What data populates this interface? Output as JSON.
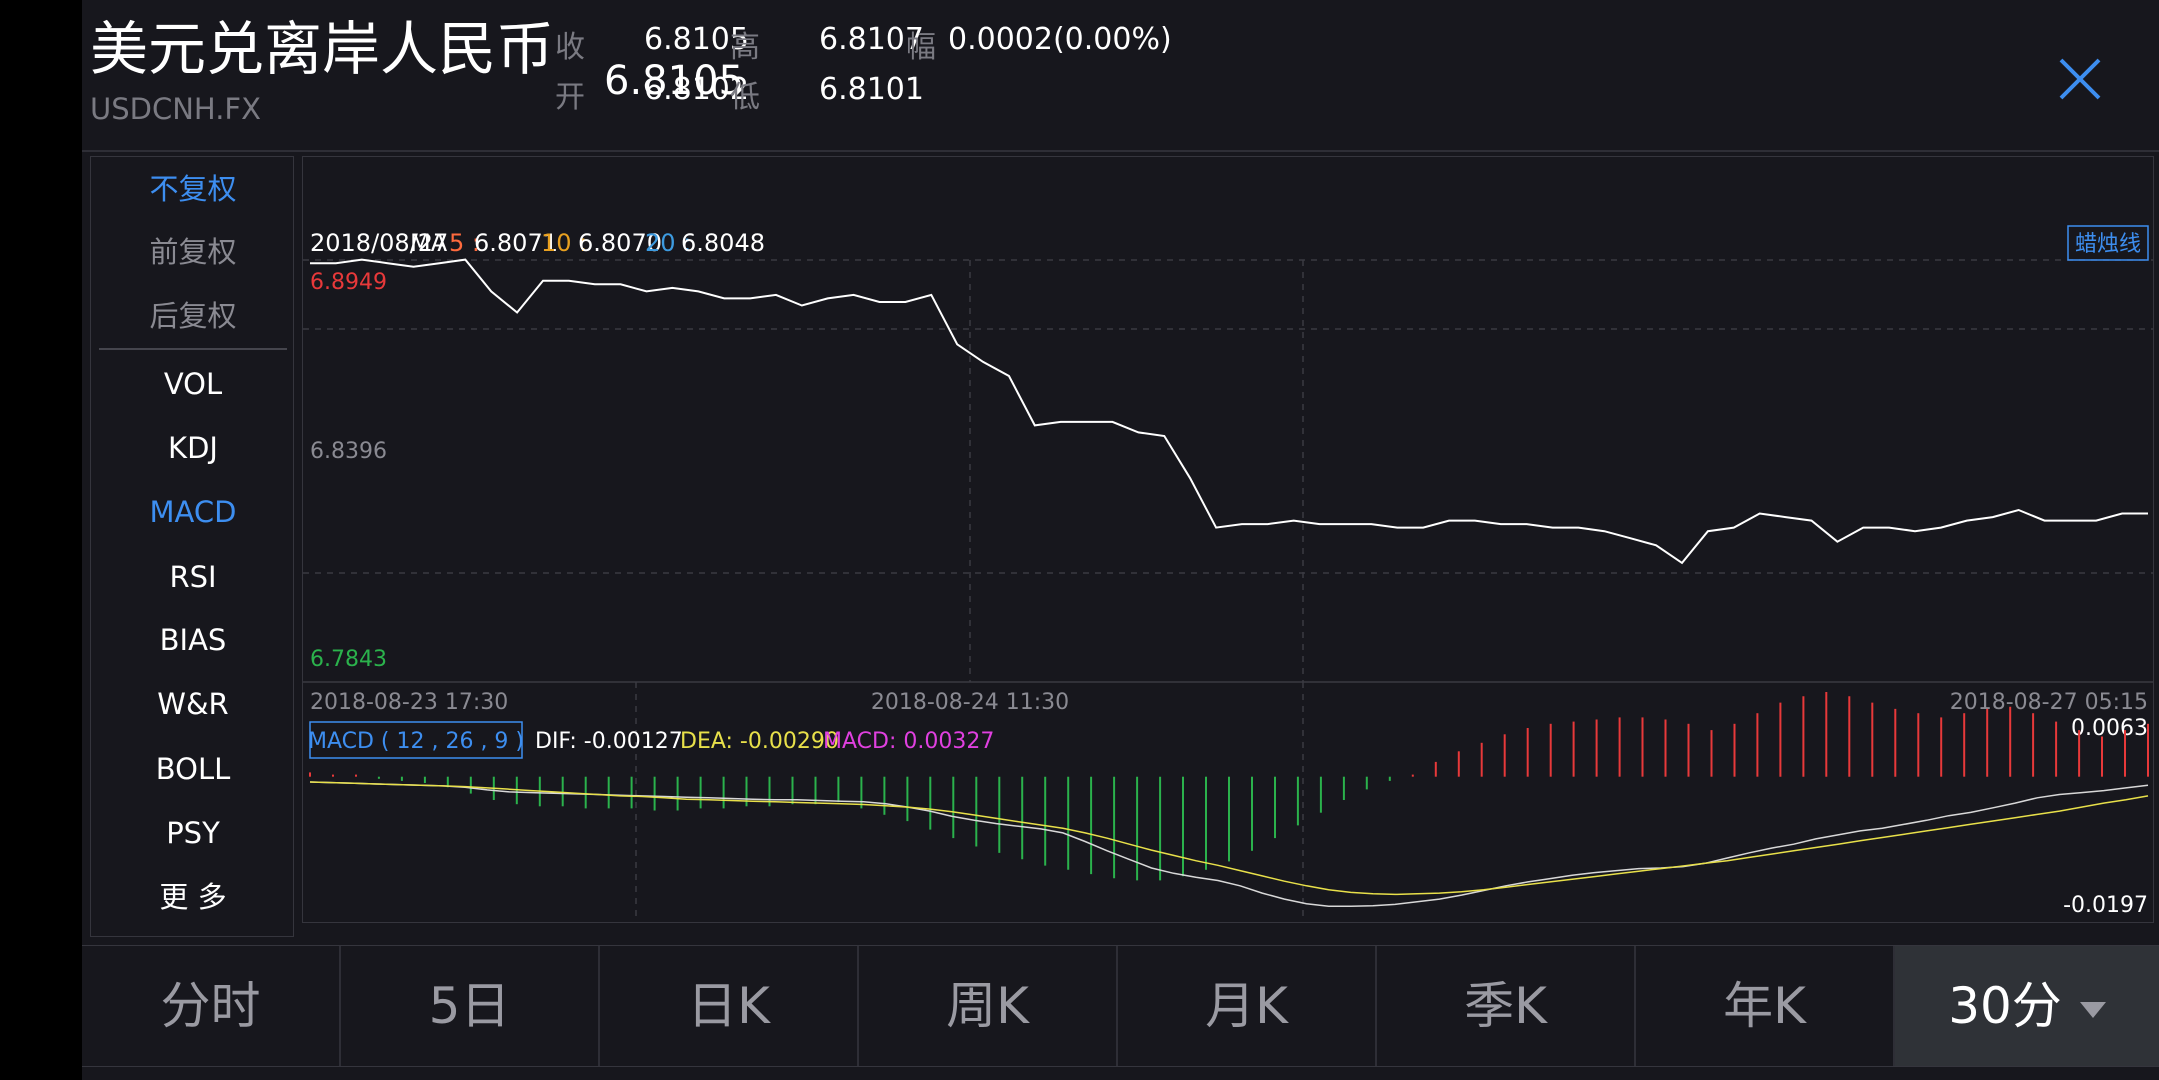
{
  "header": {
    "title": "美元兑离岸人民币",
    "code": "USDCNH.FX",
    "price": "6.8105",
    "close_label": "收",
    "close_value": "6.8105",
    "open_label": "开",
    "open_value": "6.8102",
    "high_label": "高",
    "high_value": "6.8107",
    "low_label": "低",
    "low_value": "6.8101",
    "change_label": "幅",
    "change_value": "0.0002(0.00%)"
  },
  "panel": {
    "adjust": [
      {
        "label": "不复权",
        "active": true
      },
      {
        "label": "前复权",
        "active": false
      },
      {
        "label": "后复权",
        "active": false
      }
    ],
    "indicators": [
      {
        "label": "VOL",
        "active": false
      },
      {
        "label": "KDJ",
        "active": false
      },
      {
        "label": "MACD",
        "active": true
      },
      {
        "label": "RSI",
        "active": false
      },
      {
        "label": "BIAS",
        "active": false
      },
      {
        "label": "W&R",
        "active": false
      },
      {
        "label": "BOLL",
        "active": false
      },
      {
        "label": "PSY",
        "active": false
      },
      {
        "label": "更 多",
        "active": false
      }
    ]
  },
  "chart": {
    "date": "2018/08/27",
    "ma_label": "MA",
    "ma5": "5 : ",
    "ma5_value": "6.8071",
    "ma10": "10 : ",
    "ma10_value": "6.8070",
    "ma20": "20 : ",
    "ma20_value": "6.8048",
    "candle_button": "蜡烛线",
    "y_high": "6.8949",
    "y_mid": "6.8396",
    "y_low": "6.7843",
    "time_left": "2018-08-23 17:30",
    "time_mid": "2018-08-24 11:30",
    "time_right": "2018-08-27 05:15",
    "macd_label": "MACD ( 12 , 26 , 9 )",
    "dif": "DIF: -0.00127",
    "dea": "DEA: -0.00290",
    "macd": "MACD: 0.00327",
    "macd_max": "0.0063",
    "macd_min": "-0.0197",
    "colors": {
      "up": "#e8393a",
      "down": "#2bb24c",
      "accent": "#3d8ef0",
      "dea": "#e8e04a",
      "macd": "#e040e0",
      "ma5": "#ff6a3d",
      "ma10": "#e8a020",
      "ma20": "#3d9be0"
    }
  },
  "tabs": [
    {
      "label": "分时",
      "selected": false
    },
    {
      "label": "5日",
      "selected": false
    },
    {
      "label": "日K",
      "selected": false
    },
    {
      "label": "周K",
      "selected": false
    },
    {
      "label": "月K",
      "selected": false
    },
    {
      "label": "季K",
      "selected": false
    },
    {
      "label": "年K",
      "selected": false
    },
    {
      "label": "30分",
      "selected": true
    }
  ],
  "chart_data": {
    "type": "line",
    "price_series": [
      6.894,
      6.894,
      6.895,
      6.894,
      6.893,
      6.894,
      6.895,
      6.886,
      6.88,
      6.889,
      6.889,
      6.888,
      6.888,
      6.886,
      6.887,
      6.886,
      6.884,
      6.884,
      6.885,
      6.882,
      6.884,
      6.885,
      6.883,
      6.883,
      6.885,
      6.871,
      6.866,
      6.862,
      6.848,
      6.849,
      6.849,
      6.849,
      6.846,
      6.845,
      6.833,
      6.819,
      6.82,
      6.82,
      6.821,
      6.82,
      6.82,
      6.82,
      6.819,
      6.819,
      6.821,
      6.821,
      6.82,
      6.82,
      6.819,
      6.819,
      6.818,
      6.816,
      6.814,
      6.809,
      6.818,
      6.819,
      6.823,
      6.822,
      6.821,
      6.815,
      6.819,
      6.819,
      6.818,
      6.819,
      6.821,
      6.822,
      6.824,
      6.821,
      6.821,
      6.821,
      6.823,
      6.823
    ],
    "ylim": [
      6.7843,
      6.8949
    ],
    "macd_ylim": [
      -0.0197,
      0.0063
    ],
    "dif_series": [
      -0.0008,
      -0.0009,
      -0.001,
      -0.0011,
      -0.0012,
      -0.0013,
      -0.0014,
      -0.0016,
      -0.002,
      -0.0023,
      -0.0024,
      -0.0025,
      -0.0026,
      -0.0027,
      -0.0028,
      -0.0029,
      -0.003,
      -0.0031,
      -0.0032,
      -0.0033,
      -0.0034,
      -0.0035,
      -0.0035,
      -0.0036,
      -0.0037,
      -0.0038,
      -0.0041,
      -0.0046,
      -0.0052,
      -0.006,
      -0.0066,
      -0.0071,
      -0.0075,
      -0.0079,
      -0.0085,
      -0.0098,
      -0.0112,
      -0.0125,
      -0.0138,
      -0.0146,
      -0.0152,
      -0.0157,
      -0.0165,
      -0.0176,
      -0.0185,
      -0.0192,
      -0.0196,
      -0.0196,
      -0.0195,
      -0.0193,
      -0.0189,
      -0.0185,
      -0.0179,
      -0.0172,
      -0.0165,
      -0.0159,
      -0.0154,
      -0.0149,
      -0.0145,
      -0.0142,
      -0.0139,
      -0.0138,
      -0.0136,
      -0.0131,
      -0.0123,
      -0.0115,
      -0.0108,
      -0.0102,
      -0.0094,
      -0.0088,
      -0.0082,
      -0.0078,
      -0.0072,
      -0.0066,
      -0.0059,
      -0.0054,
      -0.0047,
      -0.004,
      -0.0032,
      -0.0027,
      -0.0024,
      -0.0021,
      -0.0017,
      -0.0013
    ],
    "dea_series": [
      -0.0008,
      -0.0009,
      -0.001,
      -0.0011,
      -0.0012,
      -0.0013,
      -0.0014,
      -0.0015,
      -0.0017,
      -0.0019,
      -0.0021,
      -0.0023,
      -0.0025,
      -0.0027,
      -0.0029,
      -0.003,
      -0.0032,
      -0.0034,
      -0.0035,
      -0.0036,
      -0.0037,
      -0.0038,
      -0.0039,
      -0.004,
      -0.0041,
      -0.0042,
      -0.0044,
      -0.0046,
      -0.0049,
      -0.0053,
      -0.0058,
      -0.0063,
      -0.0068,
      -0.0073,
      -0.0078,
      -0.0085,
      -0.0093,
      -0.0102,
      -0.0111,
      -0.0119,
      -0.0127,
      -0.0134,
      -0.0142,
      -0.015,
      -0.0158,
      -0.0165,
      -0.0171,
      -0.0175,
      -0.0177,
      -0.0178,
      -0.0177,
      -0.0176,
      -0.0174,
      -0.0171,
      -0.0167,
      -0.0163,
      -0.0159,
      -0.0155,
      -0.0151,
      -0.0147,
      -0.0143,
      -0.0139,
      -0.0135,
      -0.0131,
      -0.0127,
      -0.0122,
      -0.0117,
      -0.0112,
      -0.0107,
      -0.0102,
      -0.0097,
      -0.0092,
      -0.0087,
      -0.0082,
      -0.0077,
      -0.0072,
      -0.0067,
      -0.0062,
      -0.0057,
      -0.0052,
      -0.0046,
      -0.004,
      -0.0035,
      -0.0029
    ],
    "macd_hist": [
      0.0002,
      0.0001,
      0.0001,
      -0.0001,
      -0.0002,
      -0.0003,
      -0.0005,
      -0.0008,
      -0.0011,
      -0.0013,
      -0.0014,
      -0.0014,
      -0.0015,
      -0.0015,
      -0.0015,
      -0.0016,
      -0.0016,
      -0.0015,
      -0.0015,
      -0.0014,
      -0.0014,
      -0.0013,
      -0.0013,
      -0.0012,
      -0.0015,
      -0.0018,
      -0.0021,
      -0.0025,
      -0.0029,
      -0.0033,
      -0.0036,
      -0.0039,
      -0.0042,
      -0.0044,
      -0.0046,
      -0.0048,
      -0.0049,
      -0.0049,
      -0.0047,
      -0.0044,
      -0.004,
      -0.0035,
      -0.0029,
      -0.0023,
      -0.0017,
      -0.0011,
      -0.0006,
      -0.0002,
      0.0001,
      0.0007,
      0.0012,
      0.0016,
      0.002,
      0.0023,
      0.0025,
      0.0026,
      0.0027,
      0.0028,
      0.0028,
      0.0027,
      0.0025,
      0.0022,
      0.0025,
      0.003,
      0.0035,
      0.0038,
      0.004,
      0.0038,
      0.0035,
      0.0032,
      0.003,
      0.0028,
      0.003,
      0.0032,
      0.0033,
      0.003,
      0.0026,
      0.0022,
      0.0019,
      0.0022,
      0.0025
    ]
  }
}
